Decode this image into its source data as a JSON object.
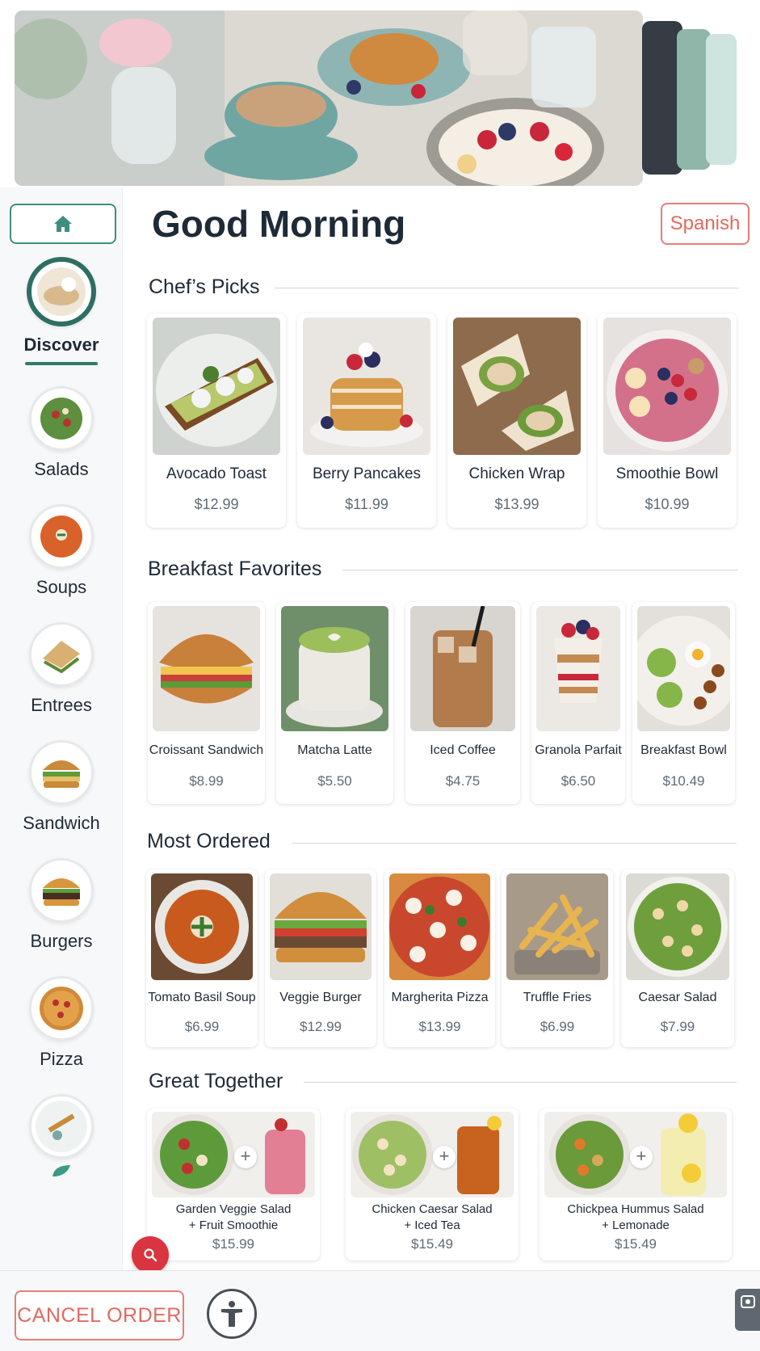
{
  "header": {
    "greeting": "Good Morning",
    "language_button": "Spanish"
  },
  "sidebar": {
    "home_icon": "home-icon",
    "categories": [
      {
        "label": "Discover",
        "active": true
      },
      {
        "label": "Salads"
      },
      {
        "label": "Soups"
      },
      {
        "label": "Entrees"
      },
      {
        "label": "Sandwich"
      },
      {
        "label": "Burgers"
      },
      {
        "label": "Pizza"
      }
    ]
  },
  "sections": {
    "chefs_picks": {
      "title": "Chef’s Picks",
      "items": [
        {
          "name": "Avocado Toast",
          "price": "$12.99"
        },
        {
          "name": "Berry Pancakes",
          "price": "$11.99"
        },
        {
          "name": "Chicken Wrap",
          "price": "$13.99"
        },
        {
          "name": "Smoothie Bowl",
          "price": "$10.99"
        }
      ]
    },
    "breakfast": {
      "title": "Breakfast Favorites",
      "items": [
        {
          "name": "Croissant Sandwich",
          "price": "$8.99"
        },
        {
          "name": "Matcha Latte",
          "price": "$5.50"
        },
        {
          "name": "Iced Coffee",
          "price": "$4.75"
        },
        {
          "name": "Granola Parfait",
          "price": "$6.50"
        },
        {
          "name": "Breakfast Bowl",
          "price": "$10.49"
        }
      ]
    },
    "most_ordered": {
      "title": "Most Ordered",
      "items": [
        {
          "name": "Tomato Basil Soup",
          "price": "$6.99"
        },
        {
          "name": "Veggie Burger",
          "price": "$12.99"
        },
        {
          "name": "Margherita Pizza",
          "price": "$13.99"
        },
        {
          "name": "Truffle Fries",
          "price": "$6.99"
        },
        {
          "name": "Caesar Salad",
          "price": "$7.99"
        }
      ]
    },
    "great_together": {
      "title": "Great Together",
      "items": [
        {
          "line1": "Garden Veggie Salad",
          "line2": "+ Fruit Smoothie",
          "price": "$15.99"
        },
        {
          "line1": "Chicken Caesar Salad",
          "line2": "+ Iced Tea",
          "price": "$15.49"
        },
        {
          "line1": "Chickpea Hummus Salad",
          "line2": "+ Lemonade",
          "price": "$15.49"
        }
      ]
    }
  },
  "footer": {
    "cancel_label": "CANCEL ORDER"
  },
  "colors": {
    "accent": "#2f7a6b",
    "danger": "#e16a5f",
    "fab": "#d9343f"
  }
}
